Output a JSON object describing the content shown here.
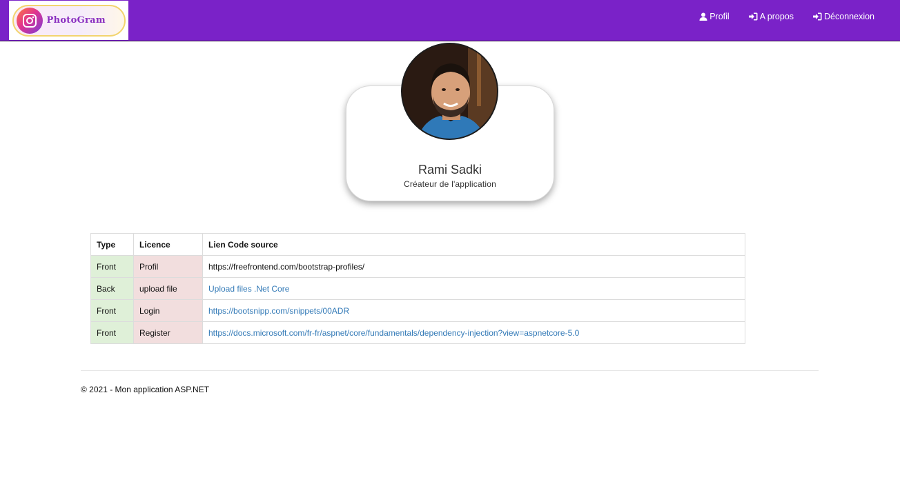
{
  "navbar": {
    "brand_text": "PhotoGram",
    "links": [
      {
        "label": "Profil",
        "icon": "user-icon"
      },
      {
        "label": "A propos",
        "icon": "sign-in-icon"
      },
      {
        "label": "Déconnexion",
        "icon": "sign-in-icon"
      }
    ],
    "color": "#7a22c8"
  },
  "profile": {
    "name": "Rami Sadki",
    "role": "Créateur de l'application"
  },
  "table": {
    "headers": [
      "Type",
      "Licence",
      "Lien Code source"
    ],
    "rows": [
      {
        "type": "Front",
        "licence": "Profil",
        "link": "https://freefrontend.com/bootstrap-profiles/"
      },
      {
        "type": "Back",
        "licence": "upload file",
        "link": "Upload files .Net Core"
      },
      {
        "type": "Front",
        "licence": "Login",
        "link": "https://bootsnipp.com/snippets/00ADR"
      },
      {
        "type": "Front",
        "licence": "Register",
        "link": "https://docs.microsoft.com/fr-fr/aspnet/core/fundamentals/dependency-injection?view=aspnetcore-5.0"
      }
    ]
  },
  "footer": {
    "text": "© 2021 - Mon application ASP.NET"
  }
}
